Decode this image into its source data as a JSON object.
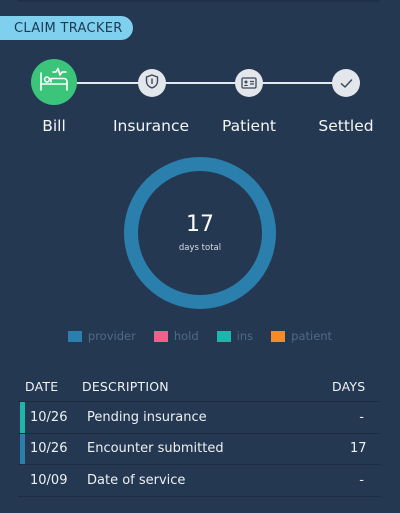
{
  "header": {
    "title": "CLAIM TRACKER"
  },
  "stepper": {
    "steps": [
      {
        "label": "Bill",
        "icon": "hospital-bed-icon",
        "state": "active"
      },
      {
        "label": "Insurance",
        "icon": "shield-icon",
        "state": "pending"
      },
      {
        "label": "Patient",
        "icon": "id-card-icon",
        "state": "pending"
      },
      {
        "label": "Settled",
        "icon": "checkmark-icon",
        "state": "pending"
      }
    ]
  },
  "summary": {
    "value": "17",
    "caption": "days total"
  },
  "chart_data": {
    "type": "pie",
    "categories": [
      "provider",
      "hold",
      "ins",
      "patient"
    ],
    "values": [
      17,
      0,
      0,
      0
    ],
    "colors": [
      "#2b7fac",
      "#f0608a",
      "#1fb5ad",
      "#f58b24"
    ],
    "legend": "bottom",
    "title": ""
  },
  "table": {
    "headers": {
      "date": "DATE",
      "description": "DESCRIPTION",
      "days": "DAYS"
    },
    "rows": [
      {
        "date": "10/26",
        "description": "Pending insurance",
        "days": "-",
        "marker": "#1fb5ad"
      },
      {
        "date": "10/26",
        "description": "Encounter submitted",
        "days": "17",
        "marker": "#2b7fac"
      },
      {
        "date": "10/09",
        "description": "Date of service",
        "days": "-",
        "marker": ""
      }
    ]
  },
  "colors": {
    "background": "#243852",
    "active_step": "#3ac57a",
    "header_pill": "#7fd0ee"
  }
}
